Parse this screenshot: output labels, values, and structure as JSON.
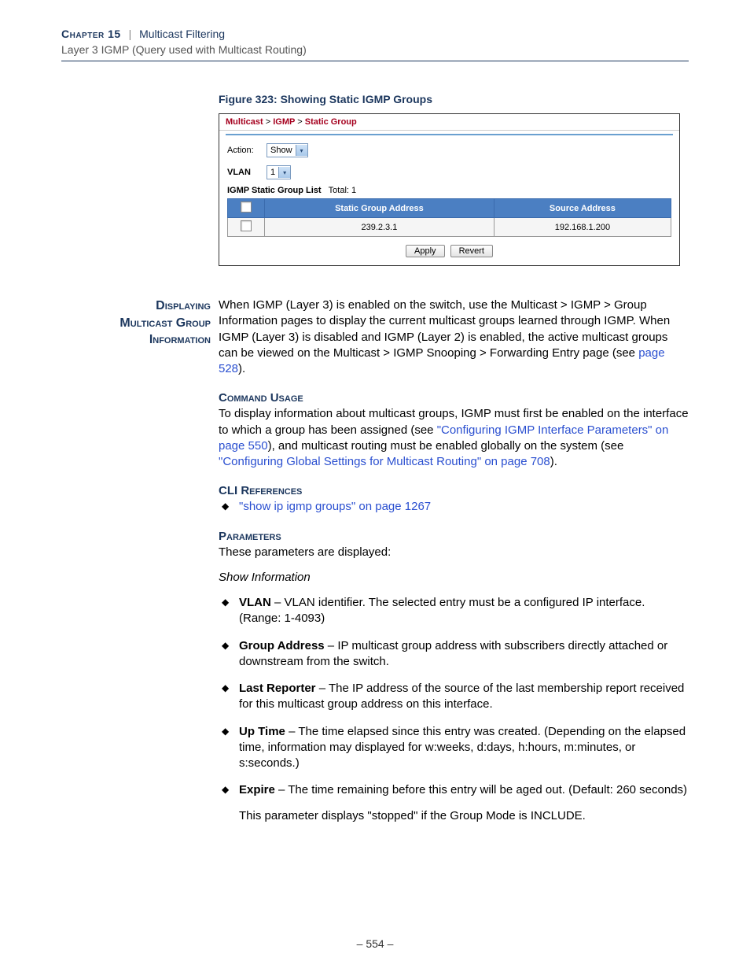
{
  "header": {
    "chapter": "Chapter 15",
    "sep": "|",
    "title": "Multicast Filtering",
    "subtitle": "Layer 3 IGMP (Query used with Multicast Routing)"
  },
  "figure": {
    "caption": "Figure 323:  Showing Static IGMP Groups",
    "breadcrumb": {
      "a": "Multicast",
      "b": "IGMP",
      "c": "Static Group",
      "sep": ">"
    },
    "action_label": "Action:",
    "action_value": "Show",
    "vlan_label": "VLAN",
    "vlan_value": "1",
    "list_label": "IGMP Static Group List",
    "list_total": "Total: 1",
    "cols": {
      "chk": "",
      "addr": "Static Group Address",
      "src": "Source Address"
    },
    "rows": [
      {
        "addr": "239.2.3.1",
        "src": "192.168.1.200"
      }
    ],
    "btn_apply": "Apply",
    "btn_revert": "Revert"
  },
  "section": {
    "margin_title_l1": "Displaying",
    "margin_title_l2": "Multicast Group",
    "margin_title_l3": "Information",
    "intro_a": "When IGMP (Layer 3) is enabled on the switch, use the Multicast > IGMP > Group Information pages to display the current multicast groups learned through IGMP. When IGMP (Layer 3) is disabled and IGMP (Layer 2) is enabled, the active multicast groups can be viewed on the Multicast > IGMP Snooping > Forwarding Entry page (see ",
    "intro_link": "page 528",
    "intro_b": ").",
    "cmd_usage_h": "Command Usage",
    "cmd_usage_a": "To display information about multicast groups, IGMP must first be enabled on the interface to which a group has been assigned (see ",
    "cmd_usage_link1": "\"Configuring IGMP Interface Parameters\" on page 550",
    "cmd_usage_b": "), and multicast routing must be enabled globally on the system (see ",
    "cmd_usage_link2": "\"Configuring Global Settings for Multicast Routing\" on page 708",
    "cmd_usage_c": ").",
    "cli_h": "CLI References",
    "cli_link": "\"show ip igmp groups\" on page 1267",
    "params_h": "Parameters",
    "params_intro": "These parameters are displayed:",
    "params_sub": "Show Information",
    "params": [
      {
        "name": "VLAN",
        "desc": " – VLAN identifier. The selected entry must be a configured IP interface. (Range: 1-4093)"
      },
      {
        "name": "Group Address",
        "desc": " – IP multicast group address with subscribers directly attached or downstream from the switch."
      },
      {
        "name": "Last Reporter",
        "desc": " – The IP address of the source of the last membership report received for this multicast group address on this interface."
      },
      {
        "name": "Up Time",
        "desc": " – The time elapsed since this entry was created. (Depending on the elapsed time, information may displayed for w:weeks, d:days, h:hours, m:minutes, or s:seconds.)"
      },
      {
        "name": "Expire",
        "desc": " – The time remaining before this entry will be aged out. (Default: 260 seconds)"
      }
    ],
    "expire_note": "This parameter displays \"stopped\" if the Group Mode is INCLUDE."
  },
  "page_number": "–  554  –"
}
